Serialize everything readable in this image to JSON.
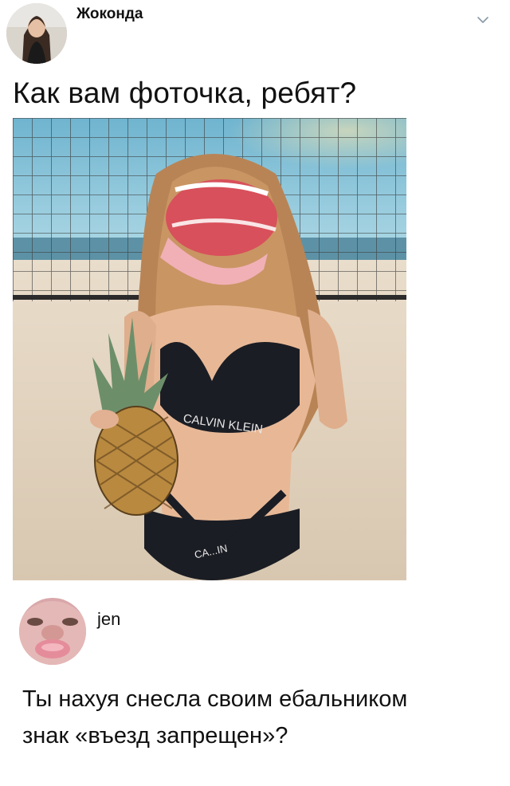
{
  "post": {
    "author": "Жоконда",
    "text": "Как вам фоточка, ребят?",
    "image_caption_top": "CALVIN KLEIN",
    "image_caption_bottom": "CA...IN"
  },
  "reply": {
    "author": "jen",
    "text_line1": "Ты нахуя снесла своим ебальником",
    "text_line2": "знак «въезд запрещен»?"
  },
  "icons": {
    "menu": "chevron-down-icon"
  }
}
